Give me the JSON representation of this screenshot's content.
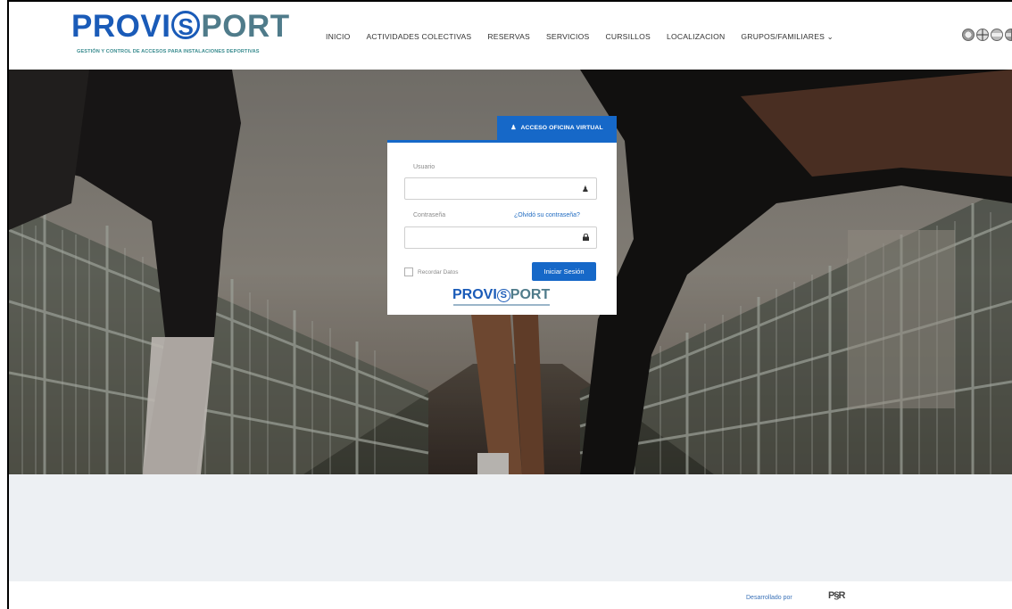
{
  "brand": {
    "logo_part1": "PROVI",
    "logo_s": "S",
    "logo_part2": "PORT",
    "tagline": "GESTIÓN Y CONTROL DE ACCESOS PARA INSTALACIONES DEPORTIVAS",
    "primary_color": "#1a5bb8",
    "secondary_color": "#4f7b8a"
  },
  "nav": {
    "items": [
      {
        "label": "INICIO"
      },
      {
        "label": "ACTIVIDADES COLECTIVAS"
      },
      {
        "label": "RESERVAS"
      },
      {
        "label": "SERVICIOS"
      },
      {
        "label": "CURSILLOS"
      },
      {
        "label": "LOCALIZACION"
      },
      {
        "label": "GRUPOS/FAMILIARES ⌄"
      }
    ]
  },
  "languages": {
    "flags": [
      "flag-icon",
      "flag-icon",
      "flag-icon",
      "flag-icon"
    ]
  },
  "login": {
    "tab_label": "ACCESO OFICINA VIRTUAL",
    "user_label": "Usuario",
    "user_value": "",
    "password_label": "Contraseña",
    "password_value": "",
    "forgot_label": "¿Olvidó su contraseña?",
    "remember_label": "Recordar Datos",
    "remember_checked": false,
    "submit_label": "Iniciar Sesión",
    "accent_color": "#1668c8"
  },
  "footer": {
    "developed_by": "Desarrollado por",
    "developer_logo": "P§R"
  }
}
